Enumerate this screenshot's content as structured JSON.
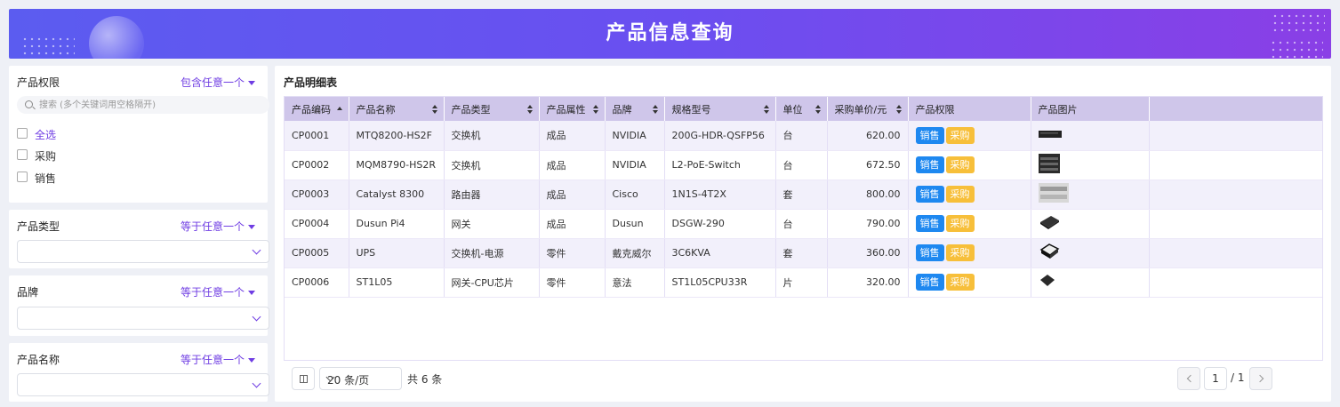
{
  "header": {
    "title": "产品信息查询"
  },
  "filters": {
    "permission": {
      "title": "产品权限",
      "mode": "包含任意一个",
      "search_placeholder": "搜索 (多个关键词用空格隔开)",
      "options": [
        "全选",
        "采购",
        "销售"
      ]
    },
    "type": {
      "title": "产品类型",
      "mode": "等于任意一个"
    },
    "brand": {
      "title": "品牌",
      "mode": "等于任意一个"
    },
    "name": {
      "title": "产品名称",
      "mode": "等于任意一个"
    }
  },
  "table": {
    "title": "产品明细表",
    "columns": [
      "产品编码",
      "产品名称",
      "产品类型",
      "产品属性",
      "品牌",
      "规格型号",
      "单位",
      "采购单价/元",
      "产品权限",
      "产品图片"
    ],
    "rows": [
      {
        "code": "CP0001",
        "name": "MTQ8200-HS2F",
        "type": "交换机",
        "attr": "成品",
        "brand": "NVIDIA",
        "model": "200G-HDR-QSFP56",
        "unit": "台",
        "price": "620.00",
        "perm": [
          "销售",
          "采购"
        ],
        "image": "switch-image"
      },
      {
        "code": "CP0002",
        "name": "MQM8790-HS2R",
        "type": "交换机",
        "attr": "成品",
        "brand": "NVIDIA",
        "model": "L2-PoE-Switch",
        "unit": "台",
        "price": "672.50",
        "perm": [
          "销售",
          "采购"
        ],
        "image": "poe-switch-image"
      },
      {
        "code": "CP0003",
        "name": "Catalyst 8300",
        "type": "路由器",
        "attr": "成品",
        "brand": "Cisco",
        "model": "1N1S-4T2X",
        "unit": "套",
        "price": "800.00",
        "perm": [
          "销售",
          "采购"
        ],
        "image": "router-image"
      },
      {
        "code": "CP0004",
        "name": "Dusun Pi4",
        "type": "网关",
        "attr": "成品",
        "brand": "Dusun",
        "model": "DSGW-290",
        "unit": "台",
        "price": "790.00",
        "perm": [
          "销售",
          "采购"
        ],
        "image": "gateway-image"
      },
      {
        "code": "CP0005",
        "name": "UPS",
        "type": "交换机-电源",
        "attr": "零件",
        "brand": "戴克威尔",
        "model": "3C6KVA",
        "unit": "套",
        "price": "360.00",
        "perm": [
          "销售",
          "采购"
        ],
        "image": "ups-image"
      },
      {
        "code": "CP0006",
        "name": "ST1L05",
        "type": "网关-CPU芯片",
        "attr": "零件",
        "brand": "意法",
        "model": "ST1L05CPU33R",
        "unit": "片",
        "price": "320.00",
        "perm": [
          "销售",
          "采购"
        ],
        "image": "chip-image"
      }
    ]
  },
  "pager": {
    "page_size": "20 条/页",
    "total": "共 6 条",
    "current": "1",
    "pages": "/ 1"
  },
  "colors": {
    "accent": "#6f3de3",
    "header_bg": "#cfc6ea",
    "sale_tag": "#1e88f0",
    "buy_tag": "#f7bf3a"
  }
}
